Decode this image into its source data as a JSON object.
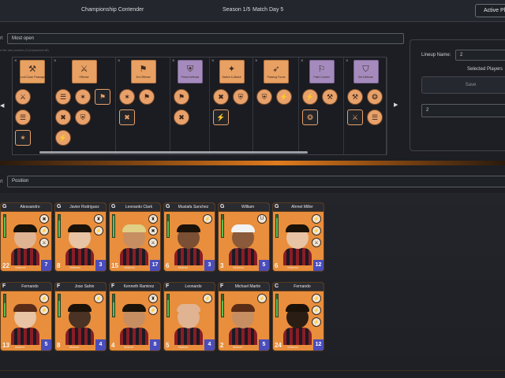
{
  "topbar": {
    "team_name": "Championship Contender",
    "season": "Season 1/5",
    "matchday": "Match Day 5",
    "active_button": "Active Pl"
  },
  "tactics": {
    "sort_label": "rt",
    "sort_value": "Most open",
    "hint": "e tier sim powers (3 (expanded off)",
    "plays": [
      {
        "name": "Lock Down Passage",
        "color": "orange",
        "glyph": "⚒",
        "highlighted": true
      },
      {
        "name": "Offense",
        "color": "orange",
        "glyph": "⚔"
      },
      {
        "name": "3rd Offense",
        "color": "orange",
        "glyph": "⚑"
      },
      {
        "name": "Press Defense",
        "color": "violet",
        "glyph": "⛨"
      },
      {
        "name": "Switch & Attack",
        "color": "orange",
        "glyph": "✦"
      },
      {
        "name": "Passing Focus",
        "color": "orange",
        "glyph": "➶"
      },
      {
        "name": "Paint Control",
        "color": "violet",
        "glyph": "⚐"
      },
      {
        "name": "Set Defense",
        "color": "violet",
        "glyph": "⛉"
      }
    ],
    "x_mark": "×",
    "left_arrow": "◀",
    "right_arrow": "▶"
  },
  "lineup": {
    "name_label": "Lineup Name:",
    "name_value": "2",
    "selected_label": "Selected Players",
    "save_label": "Save",
    "dropdown_value": "2"
  },
  "roster": {
    "sort_label": "rt",
    "sort_value": "Position",
    "players": [
      {
        "pos": "G",
        "name": "Alessandro",
        "number": "22",
        "rating": "7",
        "tag": "Veteran",
        "hair": "#1b1208",
        "skin": "#e0b393",
        "stamina": 0.9,
        "traits": [
          "✖",
          "⚡",
          "⚔"
        ]
      },
      {
        "pos": "G",
        "name": "Javier Rodriguez",
        "number": "8",
        "rating": "3",
        "tag": "Veteran",
        "hair": "#1b1208",
        "skin": "#e8c3a4",
        "stamina": 0.75,
        "traits": [
          "♜",
          "⚡"
        ]
      },
      {
        "pos": "G",
        "name": "Leonardo Clark",
        "number": "15",
        "rating": "17",
        "tag": "Veteran",
        "hair": "#e0cf85",
        "skin": "#c78e62",
        "stamina": 0.95,
        "traits": [
          "♜",
          "✖",
          "⚔"
        ]
      },
      {
        "pos": "G",
        "name": "Mustafa Sanchez",
        "number": "6",
        "rating": "3",
        "tag": "Mature",
        "hair": "#1b1208",
        "skin": "#7a4f33",
        "stamina": 0.7,
        "traits": [
          "⚡"
        ]
      },
      {
        "pos": "G",
        "name": "William",
        "number": "3",
        "rating": "5",
        "tag": "Veteran",
        "hair": "#f2f2f2",
        "skin": "#8a5a3a",
        "stamina": 0.8,
        "traits": [
          "U"
        ]
      },
      {
        "pos": "G",
        "name": "Ahmet Miller",
        "number": "6",
        "rating": "12",
        "tag": "Veteran",
        "hair": "#1b1208",
        "skin": "#e8c3a4",
        "stamina": 0.85,
        "traits": [
          "⚡",
          "⚡",
          "⚔"
        ]
      },
      {
        "pos": "F",
        "name": "Fernando",
        "number": "13",
        "rating": "5",
        "tag": "Mature",
        "hair": "#5a2c17",
        "skin": "#e8c3a4",
        "stamina": 0.6,
        "traits": [
          "⚡",
          "⚡"
        ]
      },
      {
        "pos": "F",
        "name": "Jose Sahin",
        "number": "8",
        "rating": "4",
        "tag": "Mature",
        "hair": "#1b1208",
        "skin": "#4a3324",
        "stamina": 0.7,
        "traits": [
          "⚡"
        ]
      },
      {
        "pos": "F",
        "name": "Kenneth Ramirez",
        "number": "4",
        "rating": "8",
        "tag": "Mature",
        "hair": "#1b1208",
        "skin": "#c78e62",
        "stamina": 0.65,
        "traits": [
          "♜",
          "⚡"
        ]
      },
      {
        "pos": "F",
        "name": "Leonardo",
        "number": "5",
        "rating": "4",
        "tag": "Mature",
        "hair": "#e0b393",
        "skin": "#e0b393",
        "stamina": 0.75,
        "traits": [
          "⚡"
        ]
      },
      {
        "pos": "F",
        "name": "Michael Martin",
        "number": "2",
        "rating": "5",
        "tag": "Mature",
        "hair": "#5a2c17",
        "skin": "#c78e62",
        "stamina": 0.7,
        "traits": [
          "⚡"
        ]
      },
      {
        "pos": "C",
        "name": "Fernando",
        "number": "24",
        "rating": "12",
        "tag": "Veteran",
        "hair": "#1b1208",
        "skin": "#2a1d14",
        "stamina": 0.8,
        "traits": [
          "⚡",
          "⚡",
          "⚡"
        ]
      }
    ]
  }
}
